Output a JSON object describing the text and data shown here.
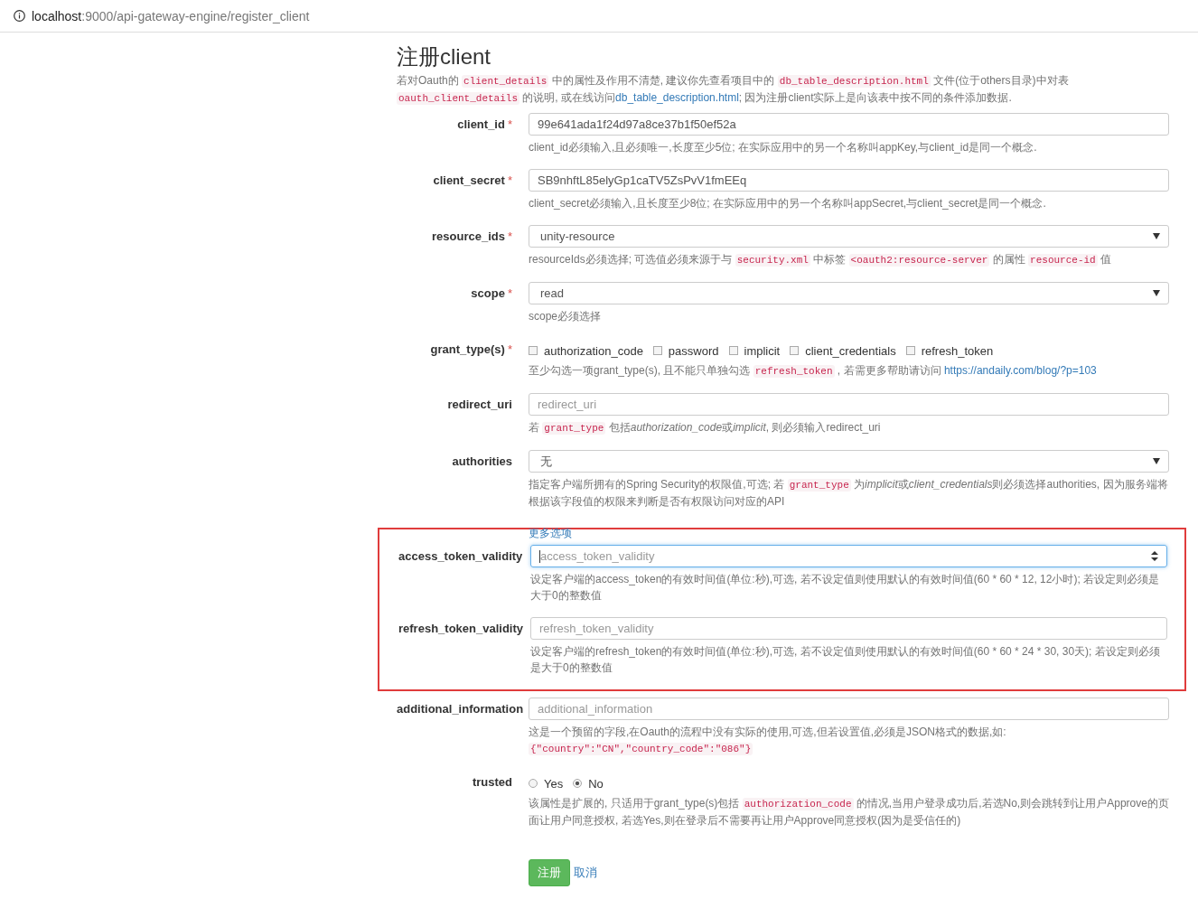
{
  "address_bar": {
    "host": "localhost",
    "path": ":9000/api-gateway-engine/register_client"
  },
  "title": "注册client",
  "intro": [
    {
      "kind": "text",
      "text": "若对Oauth的 "
    },
    {
      "kind": "code",
      "text": "client_details"
    },
    {
      "kind": "text",
      "text": " 中的属性及作用不清楚, 建议你先查看项目中的 "
    },
    {
      "kind": "code",
      "text": "db_table_description.html"
    },
    {
      "kind": "text",
      "text": " 文件(位于others目录)中对表 "
    },
    {
      "kind": "code",
      "text": "oauth_client_details"
    },
    {
      "kind": "text",
      "text": " 的说明, 或在线访问"
    },
    {
      "kind": "link",
      "text": "db_table_description.html"
    },
    {
      "kind": "text",
      "text": "; 因为注册client实际上是向该表中按不同的条件添加数据."
    }
  ],
  "fields": [
    {
      "kind": "text",
      "label": "client_id",
      "required_mark": "*",
      "value": "99e641ada1f24d97a8ce37b1f50ef52a",
      "help": [
        {
          "kind": "text",
          "text": "client_id必须输入,且必须唯一,长度至少5位; 在实际应用中的另一个名称叫appKey,与client_id是同一个概念."
        }
      ]
    },
    {
      "kind": "text",
      "label": "client_secret",
      "required_mark": "*",
      "value": "SB9nhftL85elyGp1caTV5ZsPvV1fmEEq",
      "help": [
        {
          "kind": "text",
          "text": "client_secret必须输入,且长度至少8位; 在实际应用中的另一个名称叫appSecret,与client_secret是同一个概念."
        }
      ]
    },
    {
      "kind": "select",
      "label": "resource_ids",
      "required_mark": "*",
      "value": "unity-resource",
      "help": [
        {
          "kind": "text",
          "text": "resourceIds必须选择; 可选值必须来源于与 "
        },
        {
          "kind": "code",
          "text": "security.xml"
        },
        {
          "kind": "text",
          "text": " 中标签 "
        },
        {
          "kind": "code",
          "text": "<oauth2:resource-server"
        },
        {
          "kind": "text",
          "text": " 的属性 "
        },
        {
          "kind": "code",
          "text": "resource-id"
        },
        {
          "kind": "text",
          "text": " 值"
        }
      ]
    },
    {
      "kind": "select",
      "label": "scope",
      "required_mark": "*",
      "value": "read",
      "help": [
        {
          "kind": "text",
          "text": "scope必须选择"
        }
      ]
    },
    {
      "kind": "checkboxes",
      "label": "grant_type(s)",
      "required_mark": "*",
      "options": [
        {
          "label": "authorization_code",
          "checked": false
        },
        {
          "label": "password",
          "checked": false
        },
        {
          "label": "implicit",
          "checked": false
        },
        {
          "label": "client_credentials",
          "checked": false
        },
        {
          "label": "refresh_token",
          "checked": false
        }
      ],
      "help": [
        {
          "kind": "text",
          "text": "至少勾选一项grant_type(s), 且不能只单独勾选 "
        },
        {
          "kind": "code",
          "text": "refresh_token"
        },
        {
          "kind": "text",
          "text": " , 若需更多帮助请访问 "
        },
        {
          "kind": "link",
          "text": "https://andaily.com/blog/?p=103"
        }
      ]
    },
    {
      "kind": "text",
      "label": "redirect_uri",
      "placeholder": "redirect_uri",
      "help": [
        {
          "kind": "text",
          "text": "若 "
        },
        {
          "kind": "code",
          "text": "grant_type"
        },
        {
          "kind": "text",
          "text": " 包括"
        },
        {
          "kind": "italic",
          "text": "authorization_code"
        },
        {
          "kind": "text",
          "text": "或"
        },
        {
          "kind": "italic",
          "text": "implicit"
        },
        {
          "kind": "text",
          "text": ", 则必须输入redirect_uri"
        }
      ]
    },
    {
      "kind": "select",
      "label": "authorities",
      "value": "无",
      "help": [
        {
          "kind": "text",
          "text": "指定客户端所拥有的Spring Security的权限值,可选; 若 "
        },
        {
          "kind": "code",
          "text": "grant_type"
        },
        {
          "kind": "text",
          "text": " 为"
        },
        {
          "kind": "italic",
          "text": "implicit"
        },
        {
          "kind": "text",
          "text": "或"
        },
        {
          "kind": "italic",
          "text": "client_credentials"
        },
        {
          "kind": "text",
          "text": "则必须选择authorities, 因为服务端将根据该字段值的权限来判断是否有权限访问对应的API"
        }
      ]
    }
  ],
  "more_section": {
    "highlighted": true,
    "link": "更多选项",
    "fields": [
      {
        "kind": "number",
        "label": "access_token_validity",
        "focused": true,
        "placeholder": "access_token_validity",
        "help": [
          {
            "kind": "text",
            "text": "设定客户端的access_token的有效时间值(单位:秒),可选, 若不设定值则使用默认的有效时间值(60 * 60 * 12, 12小时); 若设定则必须是大于0的整数值"
          }
        ]
      },
      {
        "kind": "text",
        "label": "refresh_token_validity",
        "focused": false,
        "placeholder": "refresh_token_validity",
        "help": [
          {
            "kind": "text",
            "text": "设定客户端的refresh_token的有效时间值(单位:秒),可选, 若不设定值则使用默认的有效时间值(60 * 60 * 24 * 30, 30天); 若设定则必须是大于0的整数值"
          }
        ]
      }
    ]
  },
  "fields_after": [
    {
      "kind": "text",
      "label": "additional_information",
      "placeholder": "additional_information",
      "help": [
        {
          "kind": "text",
          "text": "这是一个预留的字段,在Oauth的流程中没有实际的使用,可选,但若设置值,必须是JSON格式的数据,如:"
        },
        {
          "kind": "break"
        },
        {
          "kind": "code",
          "text": "{\"country\":\"CN\",\"country_code\":\"086\"}"
        }
      ]
    },
    {
      "kind": "radios",
      "label": "trusted",
      "options": [
        {
          "label": "Yes",
          "selected": false
        },
        {
          "label": "No",
          "selected": true
        }
      ],
      "help": [
        {
          "kind": "text",
          "text": "该属性是扩展的, 只适用于grant_type(s)包括 "
        },
        {
          "kind": "code",
          "text": "authorization_code"
        },
        {
          "kind": "text",
          "text": " 的情况,当用户登录成功后,若选No,则会跳转到让用户Approve的页面让用户同意授权, 若选Yes,则在登录后不需要再让用户Approve同意授权(因为是受信任的)"
        }
      ]
    }
  ],
  "submit": "注册",
  "cancel": "取消"
}
